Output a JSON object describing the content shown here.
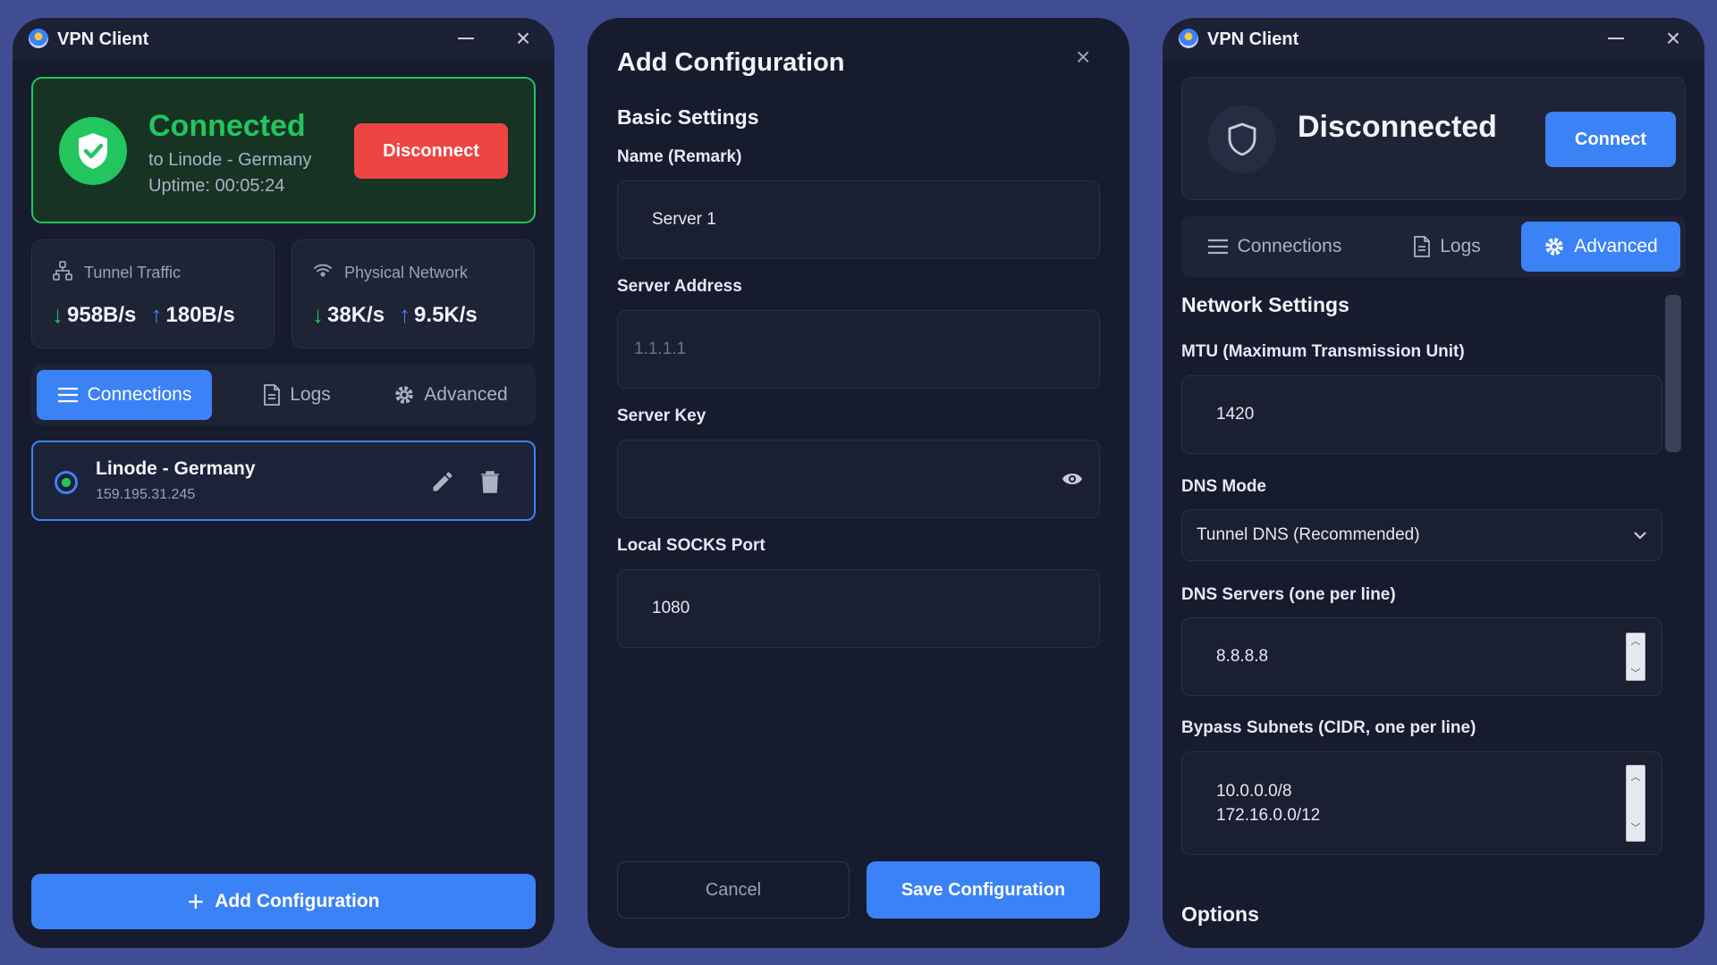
{
  "left_window": {
    "title": "VPN Client",
    "status": "Connected",
    "connected_to": "to Linode - Germany",
    "uptime": "Uptime: 00:05:24",
    "disconnect_label": "Disconnect",
    "tunnel": {
      "label": "Tunnel Traffic",
      "down": "958B/s",
      "up": "180B/s"
    },
    "physical": {
      "label": "Physical Network",
      "down": "38K/s",
      "up": "9.5K/s"
    },
    "tabs": {
      "connections": "Connections",
      "logs": "Logs",
      "advanced": "Advanced"
    },
    "active_tab": "Connections",
    "connection": {
      "name": "Linode - Germany",
      "ip": "159.195.31.245"
    },
    "add_label": "Add Configuration"
  },
  "modal": {
    "title": "Add Configuration",
    "section": "Basic Settings",
    "name_label": "Name (Remark)",
    "name_value": "Server 1",
    "address_label": "Server Address",
    "address_placeholder": "1.1.1.1",
    "key_label": "Server Key",
    "key_value": "",
    "port_label": "Local SOCKS Port",
    "port_value": "1080",
    "cancel_label": "Cancel",
    "save_label": "Save Configuration"
  },
  "right_window": {
    "title": "VPN Client",
    "status": "Disconnected",
    "connect_label": "Connect",
    "tabs": {
      "connections": "Connections",
      "logs": "Logs",
      "advanced": "Advanced"
    },
    "active_tab": "Advanced",
    "section": "Network Settings",
    "mtu_label": "MTU (Maximum Transmission Unit)",
    "mtu_value": "1420",
    "dns_mode_label": "DNS Mode",
    "dns_mode_value": "Tunnel DNS (Recommended)",
    "dns_servers_label": "DNS Servers (one per line)",
    "dns_servers_value": "8.8.8.8",
    "bypass_label": "Bypass Subnets (CIDR, one per line)",
    "bypass_lines": [
      "10.0.0.0/8",
      "172.16.0.0/12"
    ],
    "options_label": "Options"
  },
  "colors": {
    "accent": "#3b82f6",
    "success": "#22c55e",
    "danger": "#ef4444",
    "background": "#414d93",
    "panel": "#171b2e"
  }
}
